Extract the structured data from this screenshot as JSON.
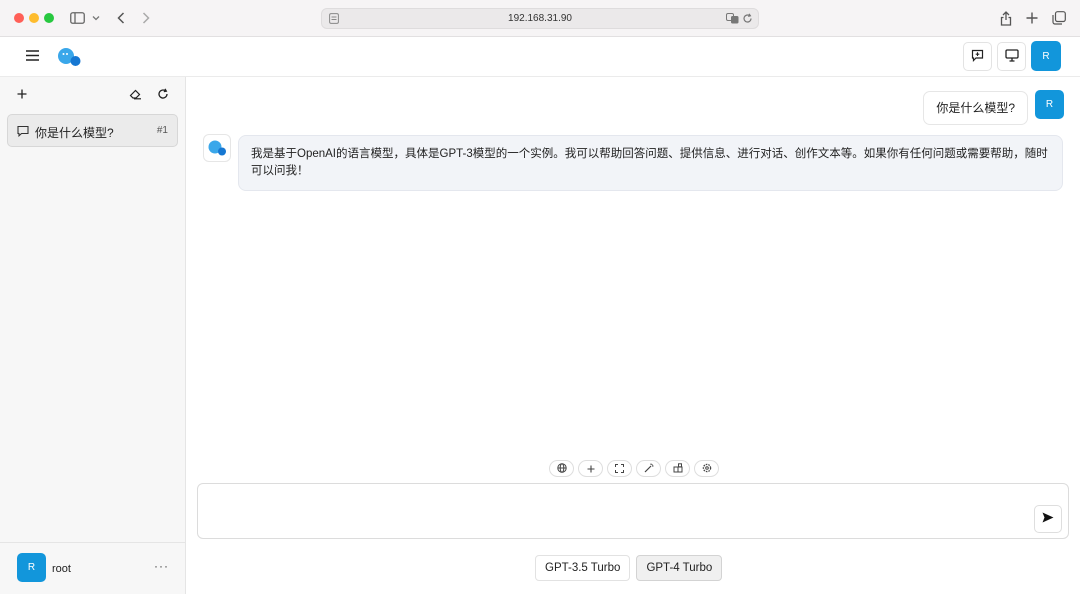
{
  "browser": {
    "url": "192.168.31.90",
    "icons": [
      "sidebar-toggle-icon",
      "chevron-down-icon",
      "back-icon",
      "forward-icon",
      "reader-icon",
      "translate-icon",
      "reload-icon",
      "share-icon",
      "new-tab-icon",
      "tabs-overview-icon"
    ]
  },
  "header": {
    "avatar_letter": "R",
    "icons": [
      "menu-icon",
      "app-logo",
      "feedback-icon",
      "display-icon"
    ]
  },
  "sidebar": {
    "conversations": [
      {
        "title": "你是什么模型?",
        "number": "#1"
      }
    ],
    "user": {
      "avatar_letter": "R",
      "name": "root",
      "more": "···"
    }
  },
  "chat": {
    "messages": [
      {
        "role": "user",
        "text": "你是什么模型?",
        "avatar_letter": "R"
      },
      {
        "role": "assistant",
        "text": "我是基于OpenAI的语言模型，具体是GPT-3模型的一个实例。我可以帮助回答问题、提供信息、进行对话、创作文本等。如果你有任何问题或需要帮助，随时可以问我！"
      }
    ],
    "tools": [
      "globe-icon",
      "plus-icon",
      "fullscreen-icon",
      "magic-wand-icon",
      "plugin-icon",
      "settings-icon"
    ],
    "input": {
      "value": "",
      "placeholder": ""
    },
    "models": [
      {
        "label": "GPT-3.5 Turbo",
        "active": false
      },
      {
        "label": "GPT-4 Turbo",
        "active": true
      }
    ]
  },
  "colors": {
    "accent": "#1296db",
    "bot_bubble": "#f2f4f8"
  }
}
